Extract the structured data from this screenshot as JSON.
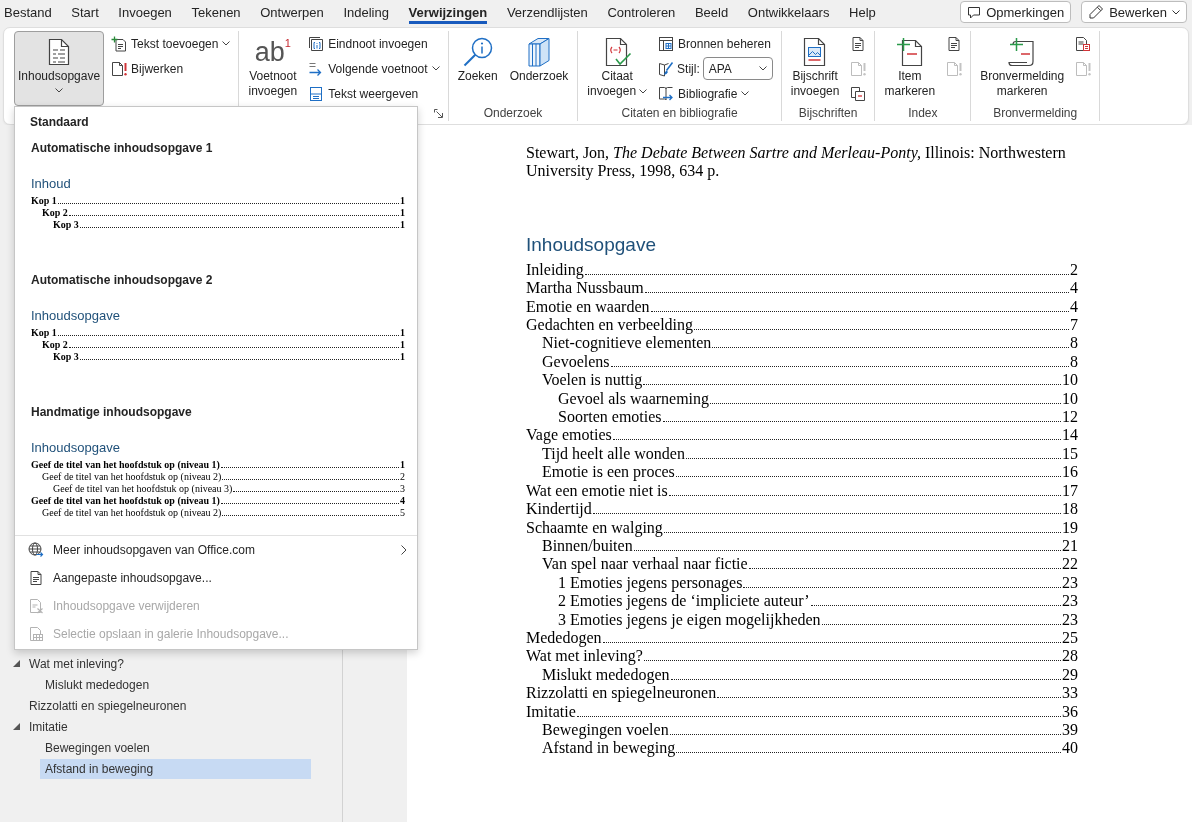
{
  "tabs": [
    {
      "label": "Bestand",
      "selected": false
    },
    {
      "label": "Start",
      "selected": false
    },
    {
      "label": "Invoegen",
      "selected": false
    },
    {
      "label": "Tekenen",
      "selected": false
    },
    {
      "label": "Ontwerpen",
      "selected": false
    },
    {
      "label": "Indeling",
      "selected": false
    },
    {
      "label": "Verwijzingen",
      "selected": true
    },
    {
      "label": "Verzendlijsten",
      "selected": false
    },
    {
      "label": "Controleren",
      "selected": false
    },
    {
      "label": "Beeld",
      "selected": false
    },
    {
      "label": "Ontwikkelaars",
      "selected": false
    },
    {
      "label": "Help",
      "selected": false
    }
  ],
  "header_buttons": [
    {
      "label": "Opmerkingen",
      "caret": false
    },
    {
      "label": "Bewerken",
      "caret": true
    }
  ],
  "ribbon": [
    {
      "launcher": false,
      "columns": [
        [
          {
            "kind": "large",
            "label": "Inhoudsopgave",
            "caret": true,
            "pressed": true
          }
        ],
        [
          {
            "kind": "small",
            "label": "Tekst toevoegen",
            "caret": true
          },
          {
            "kind": "small",
            "label": "Bijwerken",
            "caret": false
          }
        ]
      ]
    },
    {
      "launcher": true,
      "columns": [
        [
          {
            "kind": "large",
            "label": "Voetnoot invoegen",
            "glyph": "ab$^{1}$",
            "caret": false,
            "pressed": false
          }
        ],
        [
          {
            "kind": "small",
            "label": "Eindnoot invoegen",
            "caret": false
          },
          {
            "kind": "small",
            "label": "Volgende voetnoot",
            "caret": true
          },
          {
            "kind": "small",
            "label": "Tekst weergeven",
            "caret": false
          }
        ]
      ]
    },
    {
      "label": "Onderzoek",
      "launcher": false,
      "columns": [
        [
          {
            "kind": "large",
            "label": "Zoeken",
            "caret": false,
            "pressed": false
          }
        ],
        [
          {
            "kind": "large",
            "label": "Onderzoek",
            "caret": false,
            "pressed": false
          }
        ]
      ]
    },
    {
      "label": "Citaten en bibliografie",
      "launcher": false,
      "columns": [
        [
          {
            "kind": "large",
            "label": "Citaat invoegen",
            "caret": true,
            "pressed": false
          }
        ],
        [
          {
            "kind": "small",
            "label": "Bronnen beheren",
            "caret": false
          },
          {
            "kind": "select",
            "label": "Stijl:",
            "value": "APA"
          },
          {
            "kind": "small",
            "label": "Bibliografie",
            "caret": true
          }
        ]
      ]
    },
    {
      "label": "Bijschriften",
      "launcher": false,
      "columns": [
        [
          {
            "kind": "large",
            "label": "Bijschrift invoegen",
            "caret": false,
            "pressed": false
          }
        ],
        [
          {
            "kind": "icon",
            "disabled": false
          },
          {
            "kind": "icon",
            "disabled": true
          },
          {
            "kind": "icon",
            "disabled": false
          }
        ]
      ]
    },
    {
      "label": "Index",
      "launcher": false,
      "columns": [
        [
          {
            "kind": "large",
            "label": "Item markeren",
            "caret": false,
            "pressed": false
          }
        ],
        [
          {
            "kind": "icon",
            "disabled": false
          },
          {
            "kind": "icon",
            "disabled": true
          }
        ]
      ]
    },
    {
      "label": "Bronvermelding",
      "launcher": false,
      "columns": [
        [
          {
            "kind": "large",
            "label": "Bronvermelding markeren",
            "caret": false,
            "pressed": false
          }
        ],
        [
          {
            "kind": "icon",
            "disabled": false
          },
          {
            "kind": "icon",
            "disabled": true
          }
        ]
      ]
    }
  ],
  "toc_menu": {
    "category": "Standaard",
    "gallery": [
      {
        "title": "Automatische inhoudsopgave 1",
        "heading": "Inhoud",
        "entries": [
          {
            "text": "Kop 1",
            "page": "1",
            "bold": true,
            "children": [
              {
                "text": "Kop 2",
                "page": "1",
                "bold": true,
                "children": [
                  {
                    "text": "Kop 3",
                    "page": "1",
                    "bold": true
                  }
                ]
              }
            ]
          }
        ]
      },
      {
        "title": "Automatische inhoudsopgave 2",
        "heading": "Inhoudsopgave",
        "entries": [
          {
            "text": "Kop 1",
            "page": "1",
            "bold": true,
            "children": [
              {
                "text": "Kop 2",
                "page": "1",
                "bold": true,
                "children": [
                  {
                    "text": "Kop 3",
                    "page": "1",
                    "bold": true
                  }
                ]
              }
            ]
          }
        ]
      },
      {
        "title": "Handmatige inhoudsopgave",
        "heading": "Inhoudsopgave",
        "entries": [
          {
            "text": "Geef de titel van het hoofdstuk op (niveau 1)",
            "page": "1",
            "bold": true,
            "children": [
              {
                "text": "Geef de titel van het hoofdstuk op (niveau 2)",
                "page": "2",
                "bold": false,
                "children": [
                  {
                    "text": "Geef de titel van het hoofdstuk op (niveau 3)",
                    "page": "3",
                    "bold": false
                  }
                ]
              }
            ]
          },
          {
            "text": "Geef de titel van het hoofdstuk op (niveau 1)",
            "page": "4",
            "bold": true,
            "children": [
              {
                "text": "Geef de titel van het hoofdstuk op (niveau 2)",
                "page": "5",
                "bold": false
              }
            ]
          }
        ]
      }
    ],
    "commands": [
      {
        "label": "Meer inhoudsopgaven van Office.com",
        "disabled": false,
        "submenu": true
      },
      {
        "label": "Aangepaste inhoudsopgave...",
        "disabled": false,
        "submenu": false
      },
      {
        "label": "Inhoudsopgave verwijderen",
        "disabled": true,
        "submenu": false
      },
      {
        "label": "Selectie opslaan in galerie Inhoudsopgave...",
        "disabled": true,
        "submenu": false
      }
    ]
  },
  "nav_pane": {
    "headings": [
      {
        "text": "Wat met inleving?",
        "expanded": true,
        "selected": false,
        "children": [
          {
            "text": "Mislukt mededogen",
            "selected": false
          }
        ]
      },
      {
        "text": "Rizzolatti en spiegelneuronen",
        "selected": false
      },
      {
        "text": "Imitatie",
        "expanded": true,
        "selected": false,
        "children": [
          {
            "text": "Bewegingen voelen",
            "selected": false
          },
          {
            "text": "Afstand in beweging",
            "selected": true
          }
        ]
      }
    ]
  },
  "document": {
    "reference": "Stewart, Jon, *The Debate Between Sartre and Merleau-Ponty,* Illinois: Northwestern University Press, 1998, 634 p.",
    "toc_heading": "Inhoudsopgave",
    "toc": [
      {
        "text": "Inleiding",
        "page": "2"
      },
      {
        "text": "Martha Nussbaum",
        "page": "4"
      },
      {
        "text": "Emotie en waarden",
        "page": "4"
      },
      {
        "text": "Gedachten en verbeelding",
        "page": "7",
        "children": [
          {
            "text": "Niet-cognitieve elementen",
            "page": "8"
          },
          {
            "text": "Gevoelens",
            "page": "8"
          },
          {
            "text": "Voelen is nuttig",
            "page": "10",
            "children": [
              {
                "text": "Gevoel als waarneming",
                "page": "10"
              },
              {
                "text": "Soorten emoties",
                "page": "12"
              }
            ]
          }
        ]
      },
      {
        "text": "Vage emoties",
        "page": "14",
        "children": [
          {
            "text": "Tijd heelt alle wonden",
            "page": "15"
          },
          {
            "text": "Emotie is een proces",
            "page": "16"
          }
        ]
      },
      {
        "text": "Wat een emotie niet is",
        "page": "17"
      },
      {
        "text": "Kindertijd",
        "page": "18"
      },
      {
        "text": "Schaamte en walging",
        "page": "19",
        "children": [
          {
            "text": "Binnen/buiten",
            "page": "21"
          },
          {
            "text": "Van spel naar verhaal naar fictie",
            "page": "22",
            "children": [
              {
                "text": "1 Emoties jegens personages",
                "page": "23"
              },
              {
                "text": "2 Emoties jegens de ‘impliciete auteur’",
                "page": "23"
              },
              {
                "text": "3 Emoties jegens je eigen mogelijkheden",
                "page": "23"
              }
            ]
          }
        ]
      },
      {
        "text": "Mededogen",
        "page": "25"
      },
      {
        "text": "Wat met inleving?",
        "page": "28",
        "children": [
          {
            "text": "Mislukt mededogen",
            "page": "29"
          }
        ]
      },
      {
        "text": "Rizzolatti en spiegelneuronen",
        "page": "33"
      },
      {
        "text": "Imitatie",
        "page": "36",
        "children": [
          {
            "text": "Bewegingen voelen",
            "page": "39"
          },
          {
            "text": "Afstand in beweging",
            "page": "40"
          }
        ]
      }
    ]
  }
}
